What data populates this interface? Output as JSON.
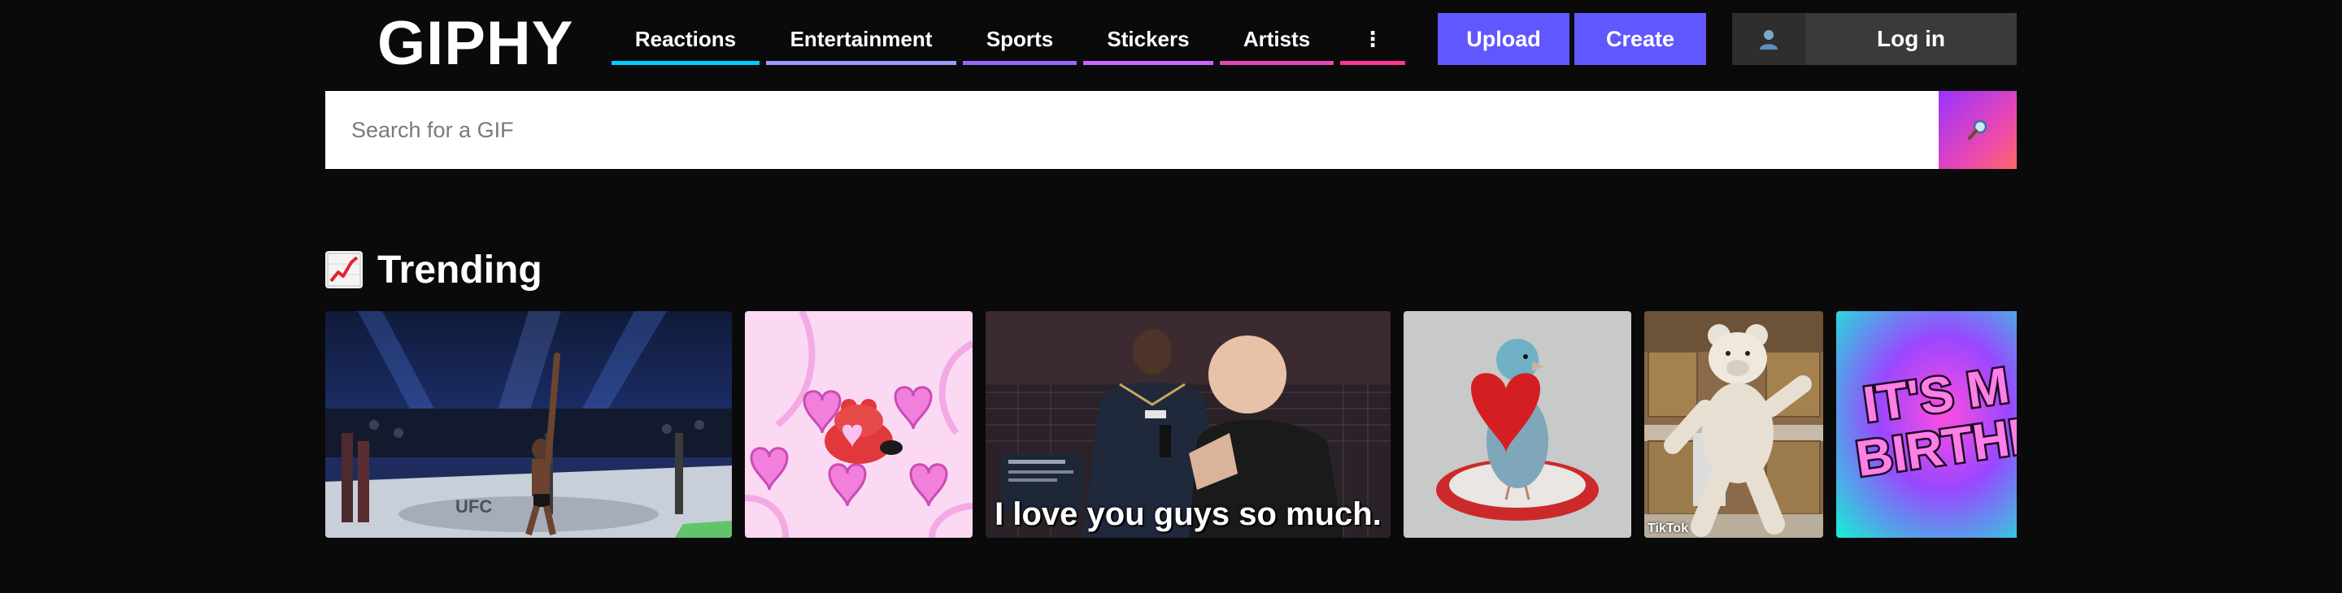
{
  "header": {
    "logo": "GIPHY",
    "nav": [
      {
        "label": "Reactions",
        "color": "#00ccff"
      },
      {
        "label": "Entertainment",
        "color": "#9999ff"
      },
      {
        "label": "Sports",
        "color": "#9966ff"
      },
      {
        "label": "Stickers",
        "color": "#cc66ff"
      },
      {
        "label": "Artists",
        "color": "#ff3399"
      },
      {
        "label": "⋮",
        "color": "#ff3399"
      }
    ],
    "upload_label": "Upload",
    "create_label": "Create",
    "login_label": "Log in",
    "login_icon": "user-avatar-icon",
    "accent": "#6157ff"
  },
  "search": {
    "placeholder": "Search for a GIF",
    "value": "",
    "icon": "search-magnifier-icon"
  },
  "trending": {
    "icon": "chart-increasing-icon",
    "title": "Trending",
    "gifs": [
      {
        "subject": "fighter-celebrating-in-octagon",
        "caption": "",
        "watermark": ""
      },
      {
        "subject": "pink-hearts-cartoon",
        "caption": "",
        "watermark": ""
      },
      {
        "subject": "post-fight-interview",
        "caption": "I love you guys so much.",
        "watermark": ""
      },
      {
        "subject": "bird-with-heart",
        "caption": "",
        "watermark": ""
      },
      {
        "subject": "dancing-bear-costume",
        "caption": "",
        "watermark": "TikTok"
      },
      {
        "subject": "birthday-text",
        "caption": "",
        "watermark": ""
      }
    ]
  }
}
